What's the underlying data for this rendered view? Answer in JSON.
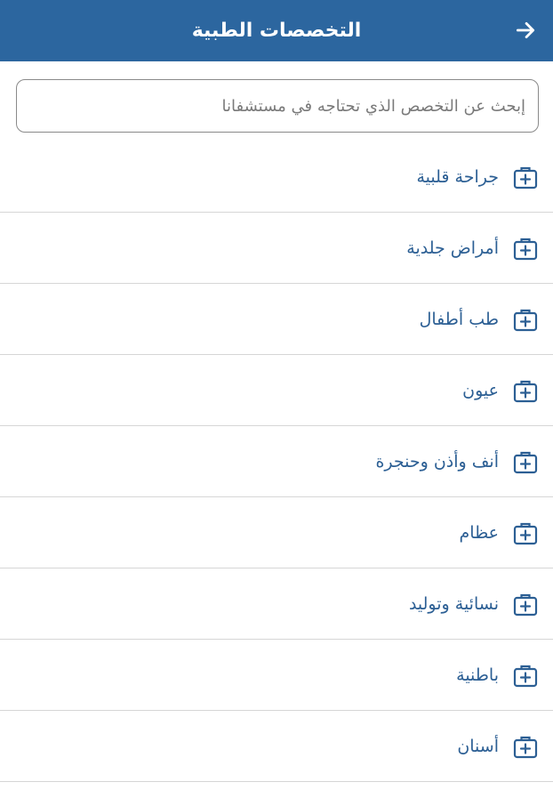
{
  "colors": {
    "header_bg": "#2c669f",
    "accent": "#2c5f94",
    "divider": "#d6d6d6"
  },
  "header": {
    "title": "التخصصات الطبية",
    "back_icon": "arrow-right-icon"
  },
  "search": {
    "placeholder": "إبحث عن التخصص الذي تحتاجه في مستشفانا",
    "value": ""
  },
  "specialties": {
    "icon": "medical-bag-icon",
    "items": [
      {
        "label": "جراحة قلبية"
      },
      {
        "label": "أمراض جلدية"
      },
      {
        "label": "طب أطفال"
      },
      {
        "label": "عيون"
      },
      {
        "label": "أنف وأذن وحنجرة"
      },
      {
        "label": "عظام"
      },
      {
        "label": "نسائية وتوليد"
      },
      {
        "label": "باطنية"
      },
      {
        "label": "أسنان"
      }
    ]
  }
}
